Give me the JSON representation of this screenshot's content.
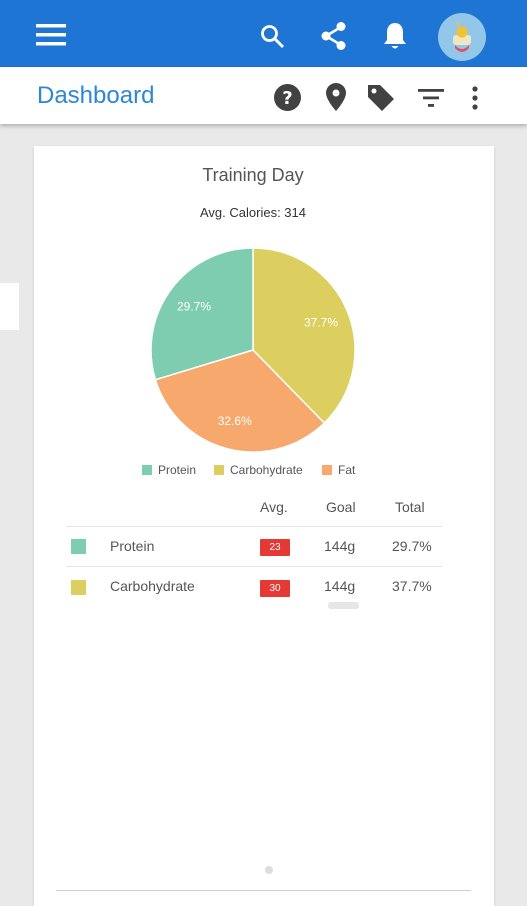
{
  "appbar": {
    "background": "#1e75d3",
    "icons": [
      "menu-icon",
      "search-icon",
      "share-icon",
      "notification-icon"
    ]
  },
  "subbar": {
    "title": "Dashboard",
    "title_color": "#2d86d6",
    "icons": [
      "help-icon",
      "location-icon",
      "tag-icon",
      "filter-icon",
      "more-vert-icon"
    ]
  },
  "card": {
    "title": "Training Day",
    "subtitle": "Avg. Calories: 314"
  },
  "chart_data": {
    "type": "pie",
    "title": "Training Day",
    "subtitle": "Avg. Calories: 314",
    "slices": [
      {
        "label": "Carbohydrate",
        "value": 37.7,
        "display": "37.7%",
        "color": "#dccf5f"
      },
      {
        "label": "Fat",
        "value": 32.6,
        "display": "32.6%",
        "color": "#f7a86c"
      },
      {
        "label": "Protein",
        "value": 29.7,
        "display": "29.7%",
        "color": "#7ecdb1"
      }
    ],
    "legend": [
      {
        "label": "Protein",
        "color": "#7ecdb1"
      },
      {
        "label": "Carbohydrate",
        "color": "#dccf5f"
      },
      {
        "label": "Fat",
        "color": "#f7a86c"
      }
    ],
    "legend_position": "bottom"
  },
  "table": {
    "headers": {
      "avg": "Avg.",
      "goal": "Goal",
      "total": "Total"
    },
    "rows": [
      {
        "name": "Protein",
        "avg": "23",
        "goal": "144g",
        "total": "29.7%",
        "color": "#7ecdb1"
      },
      {
        "name": "Carbohydrate",
        "avg": "30",
        "goal": "144g",
        "total": "37.7%",
        "color": "#dccf5f"
      }
    ],
    "badge_color": "#e53935"
  }
}
